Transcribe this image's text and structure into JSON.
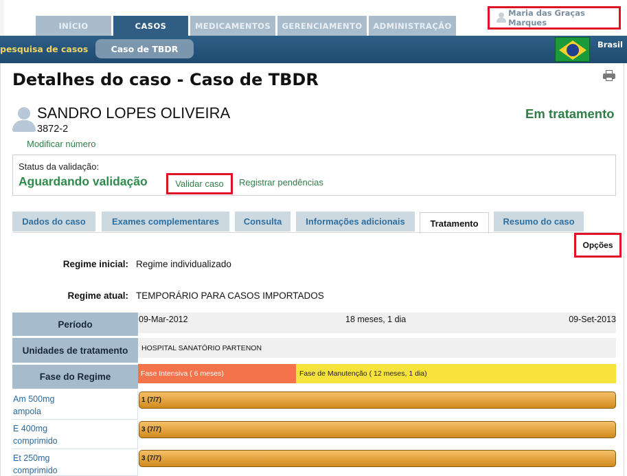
{
  "nav": {
    "tabs": [
      {
        "label": "INÍCIO",
        "active": false
      },
      {
        "label": "CASOS",
        "active": true
      },
      {
        "label": "MEDICAMENTOS",
        "active": false
      },
      {
        "label": "GERENCIAMENTO",
        "active": false
      },
      {
        "label": "ADMINISTRAÇÃO",
        "active": false
      }
    ],
    "user_name": "Maria das Graças Marques"
  },
  "breadcrumb": {
    "link": "pesquisa de casos",
    "current": "Caso de TBDR",
    "country": "Brasil"
  },
  "page": {
    "title": "Detalhes do caso - Caso de TBDR"
  },
  "patient": {
    "name": "SANDRO LOPES OLIVEIRA",
    "case_number": "3872-2",
    "modify_number": "Modificar número",
    "state": "Em tratamento"
  },
  "validation": {
    "label": "Status da validação:",
    "status": "Aguardando validação",
    "validate_button": "Validar caso",
    "pending_link": "Registrar pendências"
  },
  "case_tabs": [
    {
      "label": "Dados do caso",
      "active": false
    },
    {
      "label": "Exames complementares",
      "active": false
    },
    {
      "label": "Consulta",
      "active": false
    },
    {
      "label": "Informações adicionais",
      "active": false
    },
    {
      "label": "Tratamento",
      "active": true
    },
    {
      "label": "Resumo do caso",
      "active": false
    }
  ],
  "treatment": {
    "options_button": "Opções",
    "initial_regimen_label": "Regime inicial:",
    "initial_regimen_value": "Regime individualizado",
    "current_regimen_label": "Regime atual:",
    "current_regimen_value": "TEMPORÁRIO PARA CASOS IMPORTADOS",
    "period_label": "Período",
    "period_start": "09-Mar-2012",
    "period_duration": "18 meses, 1 dia",
    "period_end": "09-Set-2013",
    "units_label": "Unidades de tratamento",
    "unit_name": "HOSPITAL SANATÓRIO PARTENON",
    "phase_label": "Fase do Regime",
    "phase_intensive": "Fase Intensiva",
    "phase_intensive_detail": "( 6 meses)",
    "phase_maintenance": "Fase de Manutenção",
    "phase_maintenance_detail": "( 12 meses, 1 dia)",
    "medicines": [
      {
        "line1": "Am 500mg",
        "line2": "ampola",
        "bar": "1 (7/7)"
      },
      {
        "line1": "E 400mg",
        "line2": "comprimido",
        "bar": "3 (7/7)"
      },
      {
        "line1": "Et 250mg",
        "line2": "comprimido",
        "bar": "3 (7/7)"
      }
    ]
  }
}
